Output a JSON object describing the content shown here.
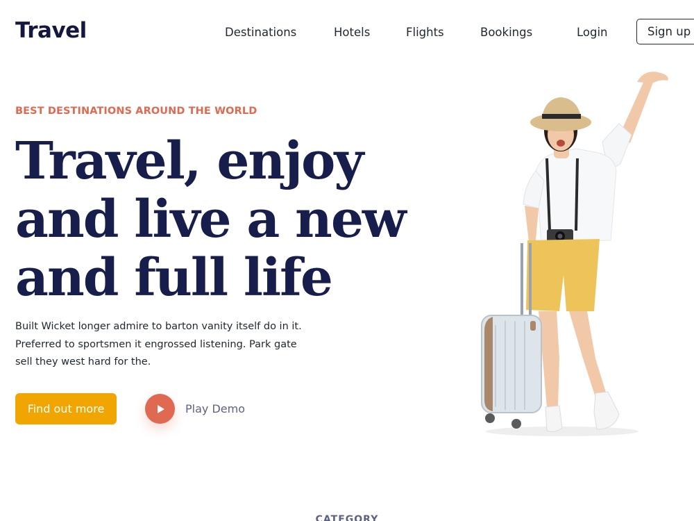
{
  "nav": {
    "logo": "Travel",
    "links": [
      "Destinations",
      "Hotels",
      "Flights",
      "Bookings",
      "Login"
    ],
    "signup": "Sign up"
  },
  "hero": {
    "eyebrow": "BEST DESTINATIONS AROUND THE WORLD",
    "headline": [
      "Travel, enjoy",
      "and live a new",
      "and full life"
    ],
    "description": [
      "Built Wicket longer admire to barton vanity itself do in it.",
      "Preferred to sportsmen it engrossed listening. Park gate",
      "sell they west hard for the."
    ],
    "cta": "Find out more",
    "play": "Play Demo"
  },
  "section": {
    "category": "CATEGORY"
  },
  "colors": {
    "accent_orange": "#DF6951",
    "cta_yellow": "#F1A501",
    "heading_navy": "#181E4B",
    "text_dark": "#212832"
  },
  "icons": {
    "play": "play-icon",
    "traveler": "traveler-illustration"
  }
}
